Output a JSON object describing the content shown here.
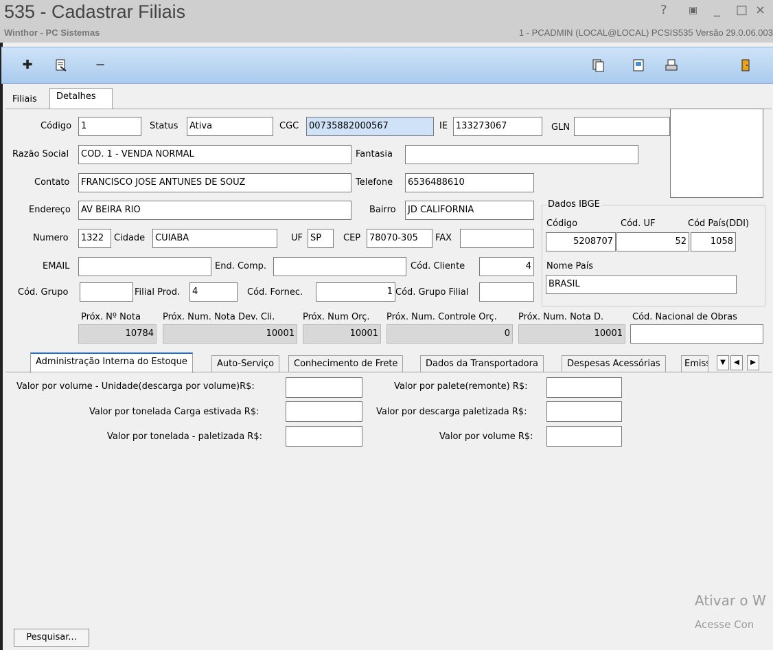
{
  "window": {
    "title": "535 - Cadastrar Filiais",
    "subtitle": "Winthor - PC Sistemas",
    "user_info": "1 - PCADMIN (LOCAL@LOCAL)  PCSIS535  Versão 29.0.06.003",
    "controls": [
      "?",
      "▣",
      "_",
      "□",
      "×"
    ]
  },
  "toolbar": {
    "icons": [
      "plus-icon",
      "edit-document-icon",
      "minus-icon",
      "copy-icon",
      "notepad-icon",
      "print-icon",
      "exit-door-icon"
    ]
  },
  "tabs": {
    "filiais": "Filiais",
    "detalhes": "Detalhes"
  },
  "form": {
    "codigo_label": "Código",
    "codigo": "1",
    "status_label": "Status",
    "status": "Ativa",
    "cgc_label": "CGC",
    "cgc": "00735882000567",
    "ie_label": "IE",
    "ie": "133273067",
    "gln_label": "GLN",
    "gln": "",
    "razao_label": "Razão Social",
    "razao": "COD. 1 - VENDA NORMAL",
    "fantasia_label": "Fantasia",
    "fantasia": "",
    "contato_label": "Contato",
    "contato": "FRANCISCO JOSE ANTUNES DE SOUZ",
    "telefone_label": "Telefone",
    "telefone": "6536488610",
    "endereco_label": "Endereço",
    "endereco": "AV BEIRA RIO",
    "bairro_label": "Bairro",
    "bairro": "JD CALIFORNIA",
    "numero_label": "Numero",
    "numero": "1322",
    "cidade_label": "Cidade",
    "cidade": "CUIABA",
    "uf_label": "UF",
    "uf": "SP",
    "cep_label": "CEP",
    "cep": "78070-305",
    "fax_label": "FAX",
    "fax": "",
    "email_label": "EMAIL",
    "email": "",
    "endcomp_label": "End. Comp.",
    "endcomp": "",
    "codcliente_label": "Cód. Cliente",
    "codcliente": "4",
    "codgrupo_label": "Cód. Grupo",
    "codgrupo": "",
    "filialprod_label": "Filial Prod.",
    "filialprod": "4",
    "codfornec_label": "Cód. Fornec.",
    "codfornec": "1",
    "codgrupofilial_label": "Cód. Grupo Filial",
    "codgrupofilial": ""
  },
  "ibge": {
    "title": "Dados IBGE",
    "codigo_label": "Código",
    "codigo": "5208707",
    "coduf_label": "Cód. UF",
    "coduf": "52",
    "codpais_label": "Cód País(DDI)",
    "codpais": "1058",
    "nomepais_label": "Nome País",
    "nomepais": "BRASIL"
  },
  "counters": {
    "prox_nota_label": "Próx. Nº Nota",
    "prox_nota": "10784",
    "prox_nota_dev_label": "Próx. Num. Nota Dev. Cli.",
    "prox_nota_dev": "10001",
    "prox_orc_label": "Próx. Num Orç.",
    "prox_orc": "10001",
    "prox_ctrl_orc_label": "Próx. Num. Controle Orç.",
    "prox_ctrl_orc": "0",
    "prox_nota_d_label": "Próx. Num. Nota D.",
    "prox_nota_d": "10001",
    "cod_obras_label": "Cód. Nacional de Obras",
    "cod_obras": ""
  },
  "subtabs": [
    "Administração Interna do Estoque",
    "Auto-Serviço",
    "Conhecimento de Frete",
    "Dados da Transportadora",
    "Despesas Acessórias",
    "Emiss"
  ],
  "estoque": {
    "vol_unidade_label": "Valor por volume - Unidade(descarga por volume)R$:",
    "ton_estivada_label": "Valor por tonelada Carga estivada R$:",
    "ton_paletizada_label": "Valor por tonelada - paletizada R$:",
    "palete_label": "Valor por palete(remonte) R$:",
    "descarga_paletizada_label": "Valor por descarga paletizada R$:",
    "volume_label": "Valor por volume R$:"
  },
  "footer": {
    "pesquisar": "Pesquisar..."
  },
  "watermark": {
    "line1": "Ativar o W",
    "line2": "Acesse Con"
  }
}
